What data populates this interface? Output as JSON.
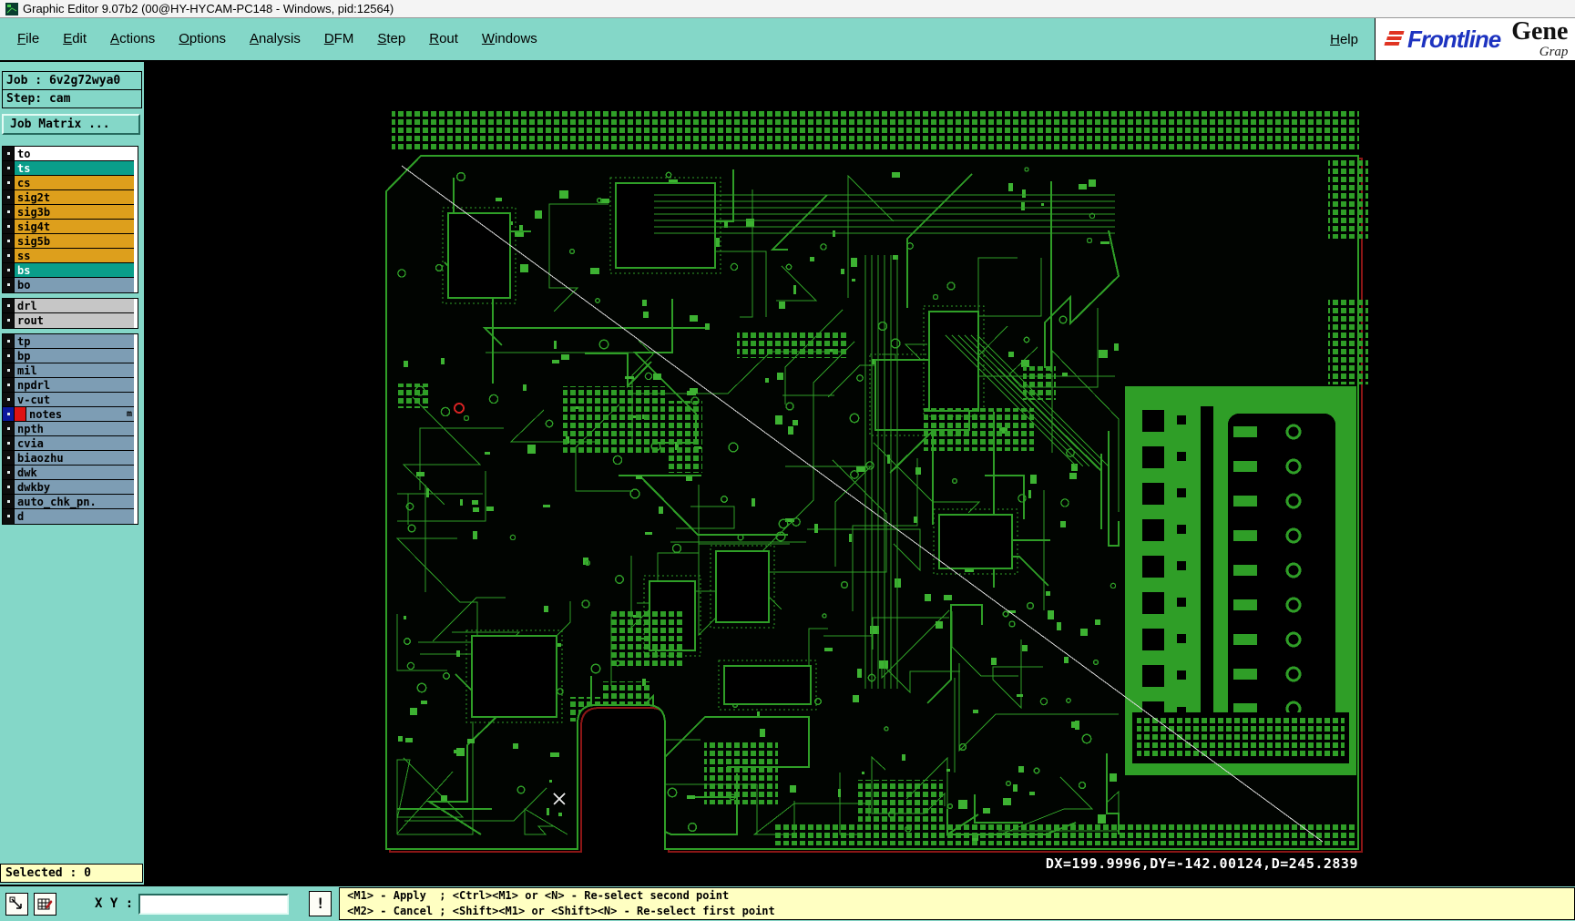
{
  "window": {
    "title": "Graphic Editor 9.07b2 (00@HY-HYCAM-PC148 - Windows, pid:12564)"
  },
  "menubar": {
    "items": [
      "File",
      "Edit",
      "Actions",
      "Options",
      "Analysis",
      "DFM",
      "Step",
      "Rout",
      "Windows"
    ],
    "help": "Help"
  },
  "brand": {
    "frontline": "Frontline",
    "product": "Gene",
    "product_sub": "Grap"
  },
  "job_panel": {
    "job": "Job : 6v2g72wya0",
    "step": "Step: cam",
    "matrix_button": "Job Matrix ..."
  },
  "layer_list": {
    "groups": [
      {
        "rows": [
          {
            "name": "to",
            "bg": "#ffffff",
            "fg": "#000000"
          },
          {
            "name": "ts",
            "bg": "#0a9e8a",
            "fg": "#ffffff"
          },
          {
            "name": "cs",
            "bg": "#dd9f1c",
            "fg": "#000000"
          },
          {
            "name": "sig2t",
            "bg": "#dd9f1c",
            "fg": "#000000"
          },
          {
            "name": "sig3b",
            "bg": "#dd9f1c",
            "fg": "#000000"
          },
          {
            "name": "sig4t",
            "bg": "#dd9f1c",
            "fg": "#000000"
          },
          {
            "name": "sig5b",
            "bg": "#dd9f1c",
            "fg": "#000000"
          },
          {
            "name": "ss",
            "bg": "#dd9f1c",
            "fg": "#000000"
          },
          {
            "name": "bs",
            "bg": "#0a9e8a",
            "fg": "#ffffff"
          },
          {
            "name": "bo",
            "bg": "#7d9db4",
            "fg": "#000000"
          }
        ]
      },
      {
        "rows": [
          {
            "name": "drl",
            "bg": "#c6c6c6",
            "fg": "#000000"
          },
          {
            "name": "rout",
            "bg": "#c6c6c6",
            "fg": "#000000"
          }
        ]
      },
      {
        "rows": [
          {
            "name": "tp",
            "bg": "#7d9db4",
            "fg": "#000000"
          },
          {
            "name": "bp",
            "bg": "#7d9db4",
            "fg": "#000000"
          },
          {
            "name": "mil",
            "bg": "#7d9db4",
            "fg": "#000000"
          },
          {
            "name": "npdrl",
            "bg": "#7d9db4",
            "fg": "#000000"
          },
          {
            "name": "v-cut",
            "bg": "#7d9db4",
            "fg": "#000000"
          },
          {
            "name": "notes",
            "bg": "#7d9db4",
            "fg": "#000000",
            "selected": true,
            "marker": "m"
          },
          {
            "name": "npth",
            "bg": "#7d9db4",
            "fg": "#000000"
          },
          {
            "name": "cvia",
            "bg": "#7d9db4",
            "fg": "#000000"
          },
          {
            "name": "biaozhu",
            "bg": "#7d9db4",
            "fg": "#000000"
          },
          {
            "name": "dwk",
            "bg": "#7d9db4",
            "fg": "#000000"
          },
          {
            "name": "dwkby",
            "bg": "#7d9db4",
            "fg": "#000000"
          },
          {
            "name": "auto_chk_pn.",
            "bg": "#7d9db4",
            "fg": "#000000"
          },
          {
            "name": "d",
            "bg": "#7d9db4",
            "fg": "#000000"
          }
        ]
      }
    ]
  },
  "canvas": {
    "readout": "DX=199.9996,DY=-142.00124,D=245.2839",
    "colors": {
      "trace": "#2f9e27",
      "bright": "#3db232",
      "profile": "#8b1616",
      "measure_line": "#d8d8d8",
      "note": "#d42222",
      "background": "#000000"
    }
  },
  "statusbar": {
    "selected": "Selected : 0"
  },
  "toolbar": {
    "xy_label": "X Y :",
    "xy_value": "",
    "alert": "!",
    "message_line1": "<M1> - Apply  ; <Ctrl><M1> or <N> - Re-select second point",
    "message_line2": "<M2> - Cancel ; <Shift><M1> or <Shift><N> - Re-select first point"
  },
  "icons": {
    "titlebar": "app-icon",
    "brand": "frontline-stripes-icon",
    "tool1": "measure-icon",
    "tool2": "grid-edit-icon"
  }
}
